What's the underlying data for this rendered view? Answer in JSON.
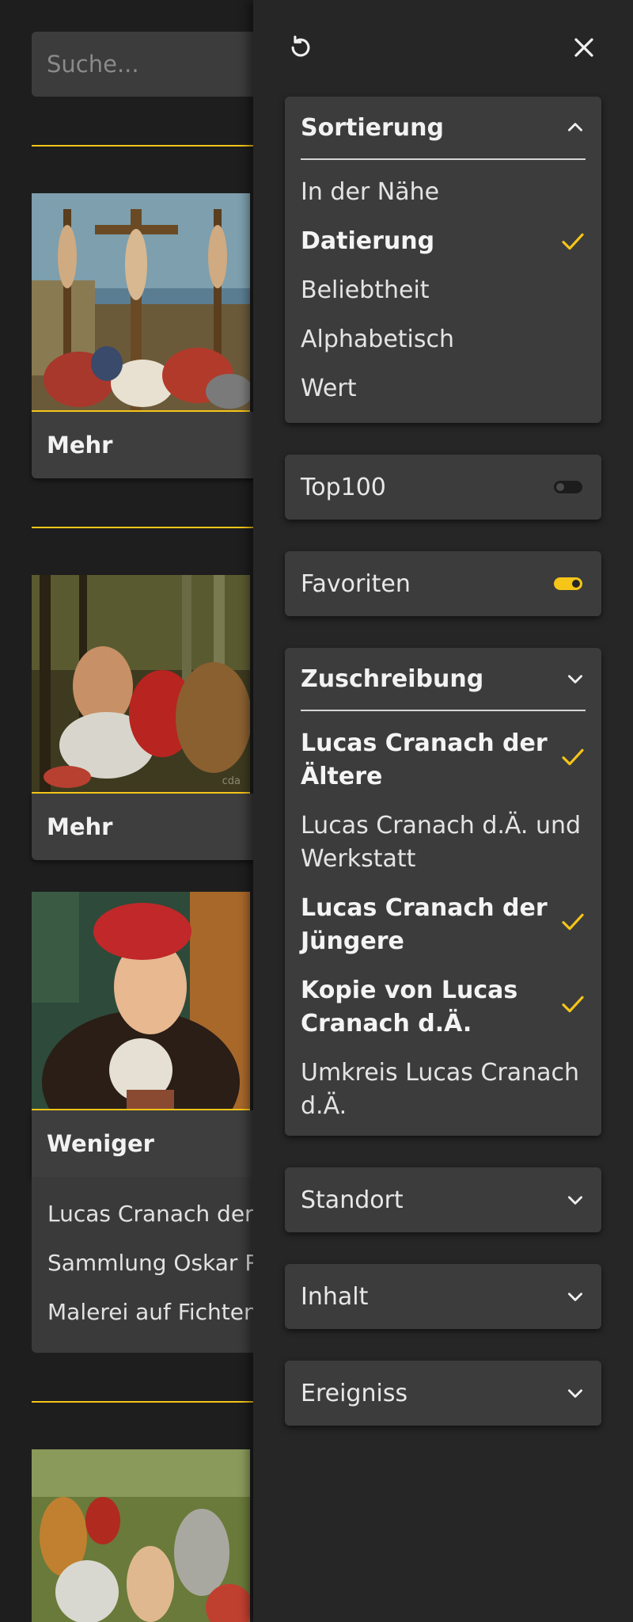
{
  "search": {
    "placeholder": "Suche..."
  },
  "cards": [
    {
      "button_label": "Mehr"
    },
    {
      "button_label": "Mehr"
    },
    {
      "button_label": "Weniger",
      "details": [
        "Lucas Cranach der",
        "Sammlung Oskar R",
        "Malerei auf Fichten"
      ]
    }
  ],
  "image_caption": "cda",
  "panel": {
    "icons": {
      "reset": "reset-icon",
      "close": "close-icon"
    },
    "sort": {
      "title": "Sortierung",
      "options": [
        {
          "label": "In der Nähe",
          "selected": false
        },
        {
          "label": "Datierung",
          "selected": true
        },
        {
          "label": "Beliebtheit",
          "selected": false
        },
        {
          "label": "Alphabetisch",
          "selected": false
        },
        {
          "label": "Wert",
          "selected": false
        }
      ]
    },
    "top100": {
      "label": "Top100",
      "on": false
    },
    "favorites": {
      "label": "Favoriten",
      "on": true
    },
    "attribution": {
      "title": "Zuschreibung",
      "options": [
        {
          "line1": "Lucas Cranach der",
          "line2": "Ältere",
          "selected": true
        },
        {
          "line1": "Lucas Cranach d.Ä. und",
          "line2": "Werkstatt",
          "selected": false
        },
        {
          "line1": "Lucas Cranach der",
          "line2": "Jüngere",
          "selected": true
        },
        {
          "line1": "Kopie von Lucas",
          "line2": "Cranach d.Ä.",
          "selected": true
        },
        {
          "line1": "Umkreis Lucas Cranach",
          "line2": "d.Ä.",
          "selected": false
        }
      ]
    },
    "location": {
      "label": "Standort"
    },
    "content": {
      "label": "Inhalt"
    },
    "event": {
      "label": "Ereigniss"
    }
  },
  "colors": {
    "accent": "#f5c518",
    "panel": "#262626",
    "box": "#3c3c3c",
    "background": "#1e1e1e"
  }
}
